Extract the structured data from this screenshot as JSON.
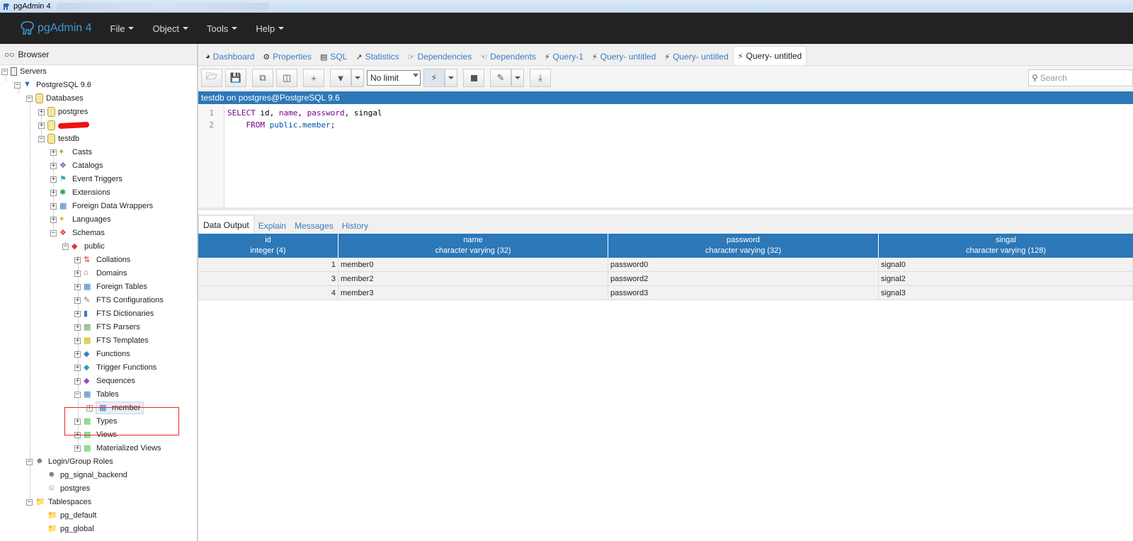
{
  "window": {
    "title": "pgAdmin 4"
  },
  "navbar": {
    "brand": "pgAdmin 4",
    "menus": [
      "File",
      "Object",
      "Tools",
      "Help"
    ]
  },
  "browser": {
    "title": "Browser",
    "tree": {
      "servers": "Servers",
      "server": "PostgreSQL 9.6",
      "databases": "Databases",
      "db_postgres": "postgres",
      "db_testdb": "testdb",
      "casts": "Casts",
      "catalogs": "Catalogs",
      "event_triggers": "Event Triggers",
      "extensions": "Extensions",
      "fdw": "Foreign Data Wrappers",
      "languages": "Languages",
      "schemas": "Schemas",
      "public": "public",
      "collations": "Collations",
      "domains": "Domains",
      "foreign_tables": "Foreign Tables",
      "fts_configurations": "FTS Configurations",
      "fts_dictionaries": "FTS Dictionaries",
      "fts_parsers": "FTS Parsers",
      "fts_templates": "FTS Templates",
      "functions": "Functions",
      "trigger_functions": "Trigger Functions",
      "sequences": "Sequences",
      "tables": "Tables",
      "member": "member",
      "types": "Types",
      "views": "Views",
      "materialized_views": "Materialized Views",
      "login_roles": "Login/Group Roles",
      "role_signal": "pg_signal_backend",
      "role_postgres": "postgres",
      "tablespaces": "Tablespaces",
      "ts_default": "pg_default",
      "ts_global": "pg_global"
    }
  },
  "tabs": [
    {
      "label": "Dashboard"
    },
    {
      "label": "Properties"
    },
    {
      "label": "SQL"
    },
    {
      "label": "Statistics"
    },
    {
      "label": "Dependencies"
    },
    {
      "label": "Dependents"
    },
    {
      "label": "Query-1"
    },
    {
      "label": "Query- untitled"
    },
    {
      "label": "Query- untitled"
    },
    {
      "label": "Query- untitled"
    }
  ],
  "toolbar": {
    "limit": "No limit",
    "search_placeholder": "Search"
  },
  "connection": "testdb on postgres@PostgreSQL 9.6",
  "editor": {
    "line1_no": "1",
    "line2_no": "2",
    "line1": {
      "kw": "SELECT",
      "rest_id": " id, ",
      "name": "name",
      "comma1": ", ",
      "password": "password",
      "comma2": ", ",
      "singal": "singal"
    },
    "line2": {
      "indent": "    ",
      "kw": "FROM",
      "sp": " ",
      "schema": "public",
      "dot": ".",
      "table": "member",
      "semi": ";"
    }
  },
  "result_tabs": [
    "Data Output",
    "Explain",
    "Messages",
    "History"
  ],
  "grid": {
    "columns": [
      {
        "name": "id",
        "type": "integer (4)"
      },
      {
        "name": "name",
        "type": "character varying (32)"
      },
      {
        "name": "password",
        "type": "character varying (32)"
      },
      {
        "name": "singal",
        "type": "character varying (128)"
      }
    ],
    "rows": [
      [
        "1",
        "member0",
        "password0",
        "signal0"
      ],
      [
        "3",
        "member2",
        "password2",
        "signal2"
      ],
      [
        "4",
        "member3",
        "password3",
        "signal3"
      ]
    ]
  },
  "colors": {
    "accent": "#2c78b8",
    "navbar": "#222222",
    "tab_link": "#3a7cc0",
    "highlight": "#ee2222"
  }
}
